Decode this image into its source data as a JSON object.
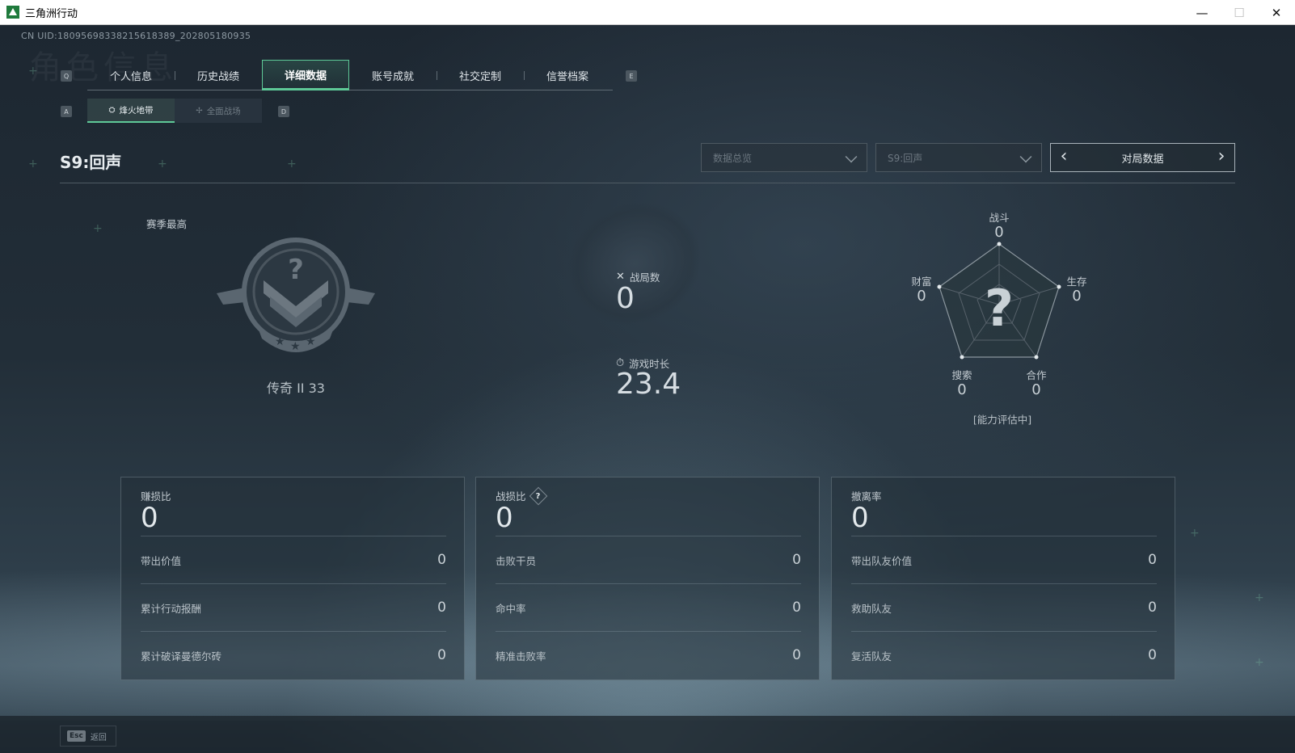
{
  "window": {
    "title": "三角洲行动",
    "minimize": "—",
    "maximize": "☐",
    "close": "✕"
  },
  "uid": "CN UID:18095698338215618389_202805180935",
  "watermark": "角色信息",
  "key_hints": {
    "tab_prev": "Q",
    "tab_next": "E",
    "sub_prev": "A",
    "sub_next": "D"
  },
  "tabs": [
    {
      "label": "个人信息",
      "active": false
    },
    {
      "label": "历史战绩",
      "active": false
    },
    {
      "label": "详细数据",
      "active": true
    },
    {
      "label": "账号成就",
      "active": false
    },
    {
      "label": "社交定制",
      "active": false
    },
    {
      "label": "信誉档案",
      "active": false
    }
  ],
  "subtabs": [
    {
      "label": "烽火地带",
      "active": true,
      "icon": "beacon-icon"
    },
    {
      "label": "全面战场",
      "active": false,
      "icon": "battlefield-icon"
    }
  ],
  "season_title": "S9:回声",
  "filters": {
    "scope": "数据总览",
    "season": "S9:回声",
    "mode": "对局数据"
  },
  "season_high": {
    "label": "赛季最高",
    "rank": "传奇 II 33",
    "icon": "rank-badge-icon"
  },
  "mid_stats": {
    "matches": {
      "label": "战局数",
      "value": "0",
      "icon": "crossed-swords-icon"
    },
    "playtime": {
      "label": "游戏时长",
      "value": "23.4",
      "icon": "stopwatch-icon"
    }
  },
  "radar": {
    "axes": [
      {
        "label": "战斗",
        "value": "0"
      },
      {
        "label": "生存",
        "value": "0"
      },
      {
        "label": "合作",
        "value": "0"
      },
      {
        "label": "搜索",
        "value": "0"
      },
      {
        "label": "财富",
        "value": "0"
      }
    ],
    "center_glyph": "?",
    "status": "[能力评估中]"
  },
  "cards": [
    {
      "title": "赚损比",
      "main_value": "0",
      "help": false,
      "rows": [
        {
          "label": "带出价值",
          "value": "0"
        },
        {
          "label": "累计行动报酬",
          "value": "0"
        },
        {
          "label": "累计破译曼德尔砖",
          "value": "0"
        }
      ]
    },
    {
      "title": "战损比",
      "main_value": "0",
      "help": true,
      "help_glyph": "?",
      "rows": [
        {
          "label": "击败干员",
          "value": "0"
        },
        {
          "label": "命中率",
          "value": "0"
        },
        {
          "label": "精准击败率",
          "value": "0"
        }
      ]
    },
    {
      "title": "撤离率",
      "main_value": "0",
      "help": false,
      "rows": [
        {
          "label": "带出队友价值",
          "value": "0"
        },
        {
          "label": "救助队友",
          "value": "0"
        },
        {
          "label": "复活队友",
          "value": "0"
        }
      ]
    }
  ],
  "footer": {
    "esc_key": "Esc",
    "esc_label": "返回"
  },
  "colors": {
    "accent": "#5ec997",
    "background": "#1f2a33",
    "text": "#d6dde2"
  }
}
